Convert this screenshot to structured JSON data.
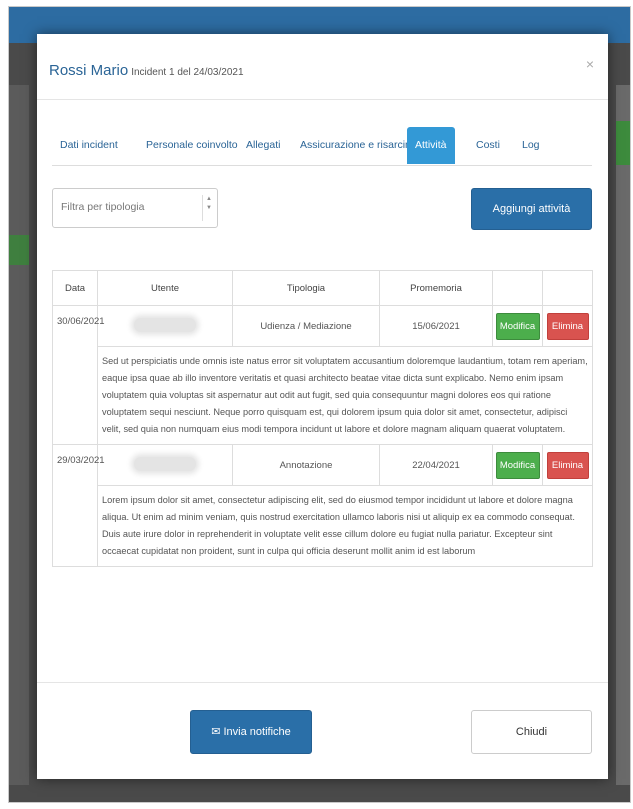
{
  "modal": {
    "title": "Rossi Mario",
    "subtitle": "Incident 1 del 24/03/2021",
    "close": "×"
  },
  "tabs": [
    {
      "label": "Dati incident"
    },
    {
      "label": "Personale coinvolto"
    },
    {
      "label": "Allegati"
    },
    {
      "label": "Assicurazione e risarcimenti"
    },
    {
      "label": "Attività"
    },
    {
      "label": "Costi"
    },
    {
      "label": "Log"
    }
  ],
  "filter": {
    "placeholder": "Filtra per tipologia"
  },
  "add_button": "Aggiungi attività",
  "table": {
    "headers": [
      "Data",
      "Utente",
      "Tipologia",
      "Promemoria"
    ],
    "rows": [
      {
        "date": "30/06/2021",
        "type": "Udienza / Mediazione",
        "reminder": "15/06/2021",
        "edit": "Modifica",
        "delete": "Elimina",
        "description": "Sed ut perspiciatis unde omnis iste natus error sit voluptatem accusantium doloremque laudantium, totam rem aperiam, eaque ipsa quae ab illo inventore veritatis et quasi architecto beatae vitae dicta sunt explicabo. Nemo enim ipsam voluptatem quia voluptas sit aspernatur aut odit aut fugit, sed quia consequuntur magni dolores eos qui ratione voluptatem sequi nesciunt. Neque porro quisquam est, qui dolorem ipsum quia dolor sit amet, consectetur, adipisci velit, sed quia non numquam eius modi tempora incidunt ut labore et dolore magnam aliquam quaerat voluptatem."
      },
      {
        "date": "29/03/2021",
        "type": "Annotazione",
        "reminder": "22/04/2021",
        "edit": "Modifica",
        "delete": "Elimina",
        "description": "Lorem ipsum dolor sit amet, consectetur adipiscing elit, sed do eiusmod tempor incididunt ut labore et dolore magna aliqua. Ut enim ad minim veniam, quis nostrud exercitation ullamco laboris nisi ut aliquip ex ea commodo consequat. Duis aute irure dolor in reprehenderit in voluptate velit esse cillum dolore eu fugiat nulla pariatur. Excepteur sint occaecat cupidatat non proident, sunt in culpa qui officia deserunt mollit anim id est laborum"
      }
    ]
  },
  "footer": {
    "send_label": "Invia notifiche",
    "close_label": "Chiudi"
  },
  "colors": {
    "primary": "#2a6fa8",
    "active_tab": "#3399d6",
    "success": "#4cae4c",
    "danger": "#d9534f",
    "link": "#2a6496"
  },
  "icons": {
    "send": "envelope-icon",
    "close": "close-icon",
    "select": "select-arrows-icon"
  }
}
